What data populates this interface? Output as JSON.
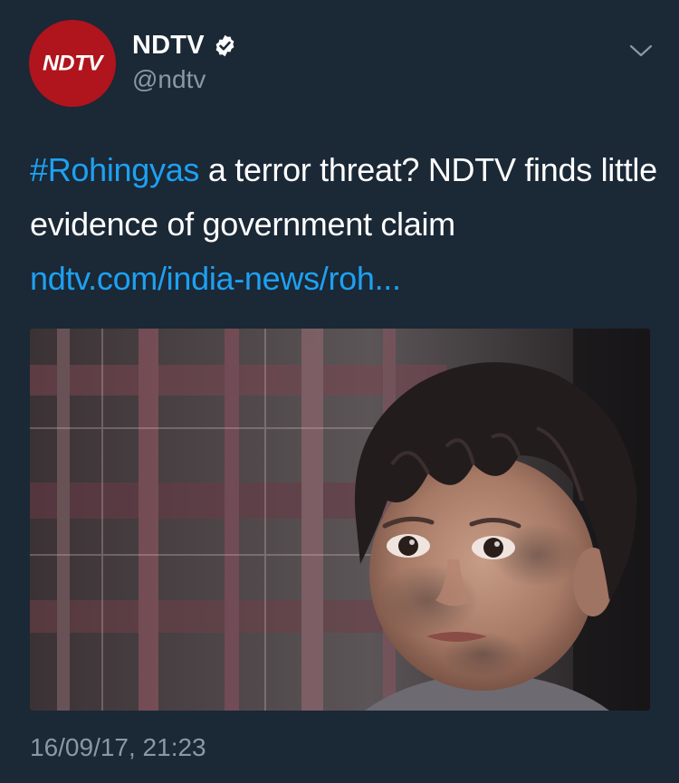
{
  "author": {
    "avatar_text": "NDTV",
    "display_name": "NDTV",
    "handle": "@ndtv",
    "verified": true,
    "avatar_color": "#b0141c"
  },
  "tweet": {
    "hashtag": "#Rohingyas",
    "text": " a terror threat? NDTV finds little evidence of government claim",
    "link": "ndtv.com/india-news/roh...",
    "timestamp": "16/09/17, 21:23"
  },
  "media": {
    "description_icon": "photo-child"
  },
  "colors": {
    "background": "#1b2836",
    "accent": "#1da1f2",
    "secondary_text": "#8899a6"
  }
}
